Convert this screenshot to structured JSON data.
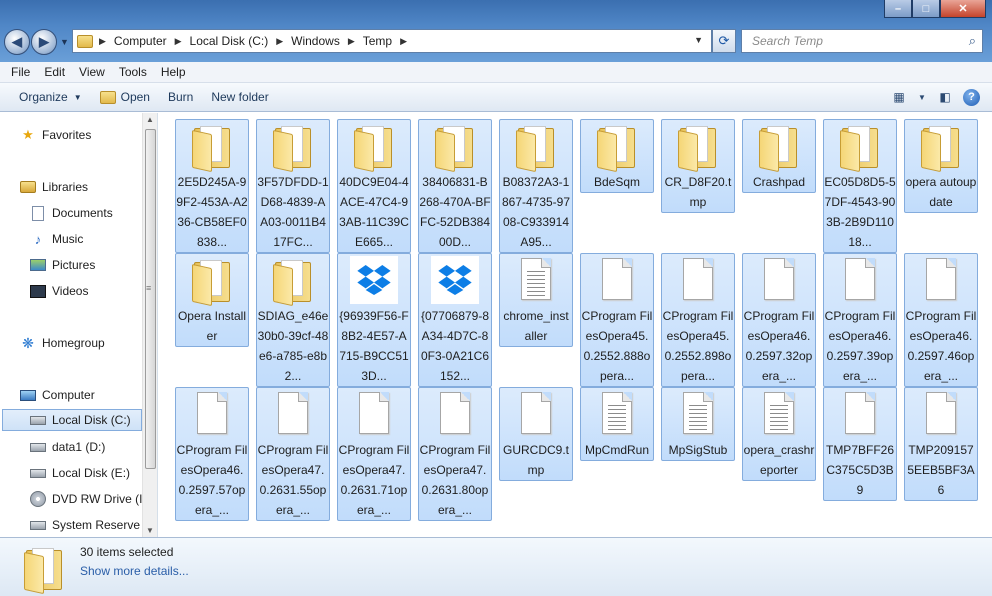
{
  "window": {
    "controls": {
      "minimize": "–",
      "maximize": "□",
      "close": "✕"
    }
  },
  "address": {
    "crumbs": [
      "Computer",
      "Local Disk (C:)",
      "Windows",
      "Temp"
    ],
    "search_placeholder": "Search Temp"
  },
  "menu": [
    "File",
    "Edit",
    "View",
    "Tools",
    "Help"
  ],
  "toolbar": {
    "organize": "Organize",
    "open": "Open",
    "burn": "Burn",
    "new_folder": "New folder"
  },
  "nav": {
    "favorites": "Favorites",
    "libraries": "Libraries",
    "documents": "Documents",
    "music": "Music",
    "pictures": "Pictures",
    "videos": "Videos",
    "homegroup": "Homegroup",
    "computer": "Computer",
    "local_c": "Local Disk (C:)",
    "data1": "data1 (D:)",
    "local_e": "Local Disk (E:)",
    "dvd": "DVD RW Drive (I",
    "system_reserved": "System Reserve"
  },
  "items": [
    {
      "type": "folder",
      "label": "2E5D245A-99F2-453A-A236-CB58EF0838..."
    },
    {
      "type": "folder",
      "label": "3F57DFDD-1D68-4839-AA03-0011B417FC..."
    },
    {
      "type": "folder",
      "label": "40DC9E04-4ACE-47C4-93AB-11C39CE665..."
    },
    {
      "type": "folder",
      "label": "38406831-B268-470A-BFFC-52DB38400D..."
    },
    {
      "type": "folder",
      "label": "B08372A3-1867-4735-9708-C933914A95..."
    },
    {
      "type": "folder",
      "label": "BdeSqm"
    },
    {
      "type": "folder",
      "label": "CR_D8F20.tmp"
    },
    {
      "type": "folder",
      "label": "Crashpad"
    },
    {
      "type": "folder",
      "label": "EC05D8D5-57DF-4543-903B-2B9D11018..."
    },
    {
      "type": "folder",
      "label": "opera autoupdate"
    },
    {
      "type": "folder",
      "label": "Opera Installer"
    },
    {
      "type": "folder",
      "label": "SDIAG_e46e30b0-39cf-48e6-a785-e8b2..."
    },
    {
      "type": "dropbox",
      "label": "{96939F56-F8B2-4E57-A715-B9CC513D..."
    },
    {
      "type": "dropbox",
      "label": "{07706879-8A34-4D7C-80F3-0A21C6152..."
    },
    {
      "type": "textfile",
      "label": "chrome_installer"
    },
    {
      "type": "file",
      "label": "CProgram FilesOpera45.0.2552.888opera..."
    },
    {
      "type": "file",
      "label": "CProgram FilesOpera45.0.2552.898opera..."
    },
    {
      "type": "file",
      "label": "CProgram FilesOpera46.0.2597.32opera_..."
    },
    {
      "type": "file",
      "label": "CProgram FilesOpera46.0.2597.39opera_..."
    },
    {
      "type": "file",
      "label": "CProgram FilesOpera46.0.2597.46opera_..."
    },
    {
      "type": "file",
      "label": "CProgram FilesOpera46.0.2597.57opera_..."
    },
    {
      "type": "file",
      "label": "CProgram FilesOpera47.0.2631.55opera_..."
    },
    {
      "type": "file",
      "label": "CProgram FilesOpera47.0.2631.71opera_..."
    },
    {
      "type": "file",
      "label": "CProgram FilesOpera47.0.2631.80opera_..."
    },
    {
      "type": "file",
      "label": "GURCDC9.tmp"
    },
    {
      "type": "textfile",
      "label": "MpCmdRun"
    },
    {
      "type": "textfile",
      "label": "MpSigStub"
    },
    {
      "type": "textfile",
      "label": "opera_crashreporter"
    },
    {
      "type": "file",
      "label": "TMP7BFF26C375C5D3B9"
    },
    {
      "type": "file",
      "label": "TMP2091575EEB5BF3A6"
    }
  ],
  "details": {
    "count": "30 items selected",
    "more": "Show more details..."
  }
}
